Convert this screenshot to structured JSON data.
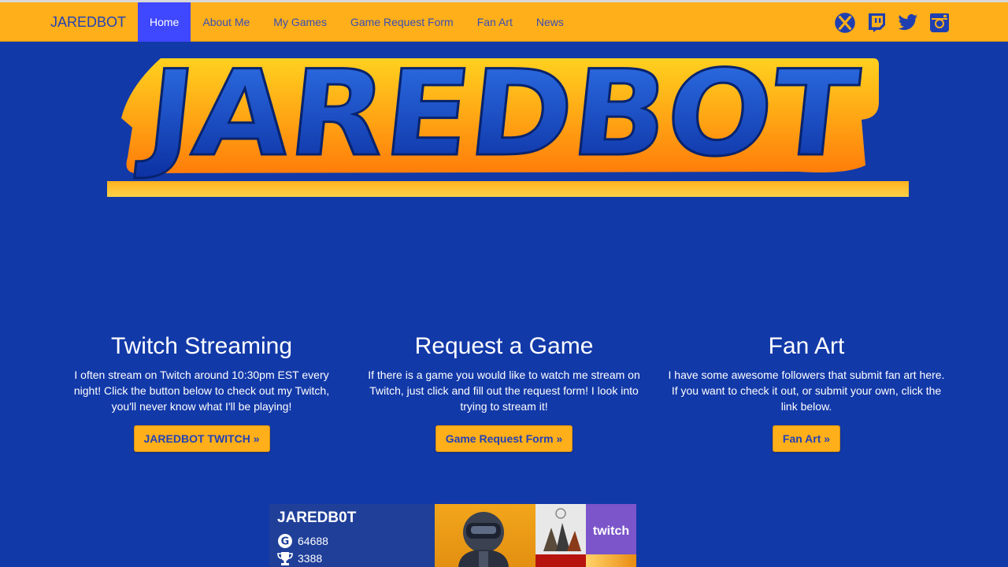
{
  "navbar": {
    "brand": "JAREDBOT",
    "items": [
      {
        "label": "Home",
        "active": true
      },
      {
        "label": "About Me",
        "active": false
      },
      {
        "label": "My Games",
        "active": false
      },
      {
        "label": "Game Request Form",
        "active": false
      },
      {
        "label": "Fan Art",
        "active": false
      },
      {
        "label": "News",
        "active": false
      }
    ],
    "social_icons": [
      "xbox-icon",
      "twitch-icon",
      "twitter-icon",
      "instagram-icon"
    ]
  },
  "hero": {
    "logo_text": "JAREDBOT"
  },
  "columns": [
    {
      "title": "Twitch Streaming",
      "text": "I often stream on Twitch around 10:30pm EST every night! Click the button below to check out my Twitch, you'll never know what I'll be playing!",
      "button": "JAREDBOT TWITCH »"
    },
    {
      "title": "Request a Game",
      "text": "If there is a game you would like to watch me stream on Twitch, just click and fill out the request form! I look into trying to stream it!",
      "button": "Game Request Form »"
    },
    {
      "title": "Fan Art",
      "text": "I have some awesome followers that submit fan art here. If you want to check it out, or submit your own, click the link below.",
      "button": "Fan Art »"
    }
  ],
  "gamercard": {
    "gamertag": "JAREDB0T",
    "gamerscore": "64688",
    "achievements": "3388",
    "tile_twitch_label": "twitch"
  },
  "colors": {
    "background": "#1239a8",
    "navbar": "#ffaf1a",
    "active_nav": "#3f47ff",
    "link": "#2342b4",
    "button": "#ffaf1a"
  }
}
